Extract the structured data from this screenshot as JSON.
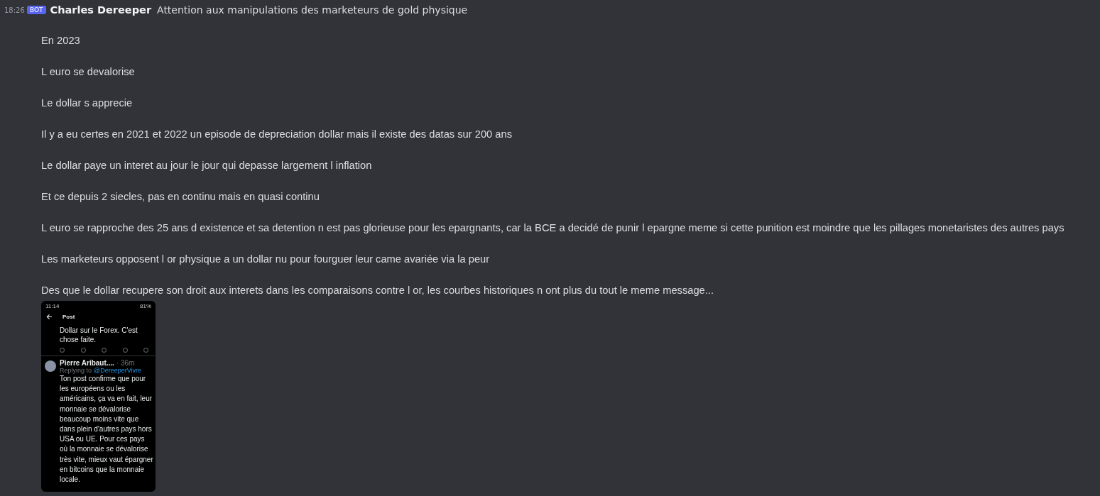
{
  "message": {
    "timestamp": "18:26",
    "badge": "BOT",
    "author": "Charles Dereeper",
    "first_line": "Attention aux manipulations des marketeurs de gold physique",
    "paragraphs": [
      "En 2023",
      "L euro se devalorise",
      "Le dollar s apprecie",
      "Il y a eu certes en 2021 et 2022 un episode de depreciation dollar  mais il existe des datas sur 200 ans",
      "Le dollar paye un interet au jour le jour qui depasse largement l inflation",
      "Et ce depuis 2 siecles, pas en continu mais en quasi continu",
      "L euro se rapproche des 25 ans d existence et sa detention n est pas glorieuse pour les epargnants, car la BCE a decidé de punir l epargne meme si cette punition est moindre que les pillages monetaristes des autres pays",
      "Les marketeurs opposent l or physique a un dollar nu pour fourguer leur came avariée via la peur",
      "Des que le dollar recupere son droit aux interets dans les comparaisons contre l or, les courbes historiques n ont plus du tout le meme message..."
    ],
    "attachment": {
      "status_time": "11:14",
      "battery": "81%",
      "header": "Post",
      "previous_post": "Dollar sur le Forex. C'est chose faite.",
      "reply": {
        "author": "Pierre Aribaut....",
        "age": "· 36m",
        "replying_to": "Replying to",
        "handle": "@DereeperVivre",
        "text": "Ton post confirme que pour les européens ou les américains, ça va en fait, leur monnaie se dévalorise beaucoup moins vite que dans plein d'autres pays hors USA ou UE. Pour ces pays où la monnaie se dévalorise très vite, mieux vaut épargner en bitcoins que la monnaie locale."
      }
    }
  }
}
